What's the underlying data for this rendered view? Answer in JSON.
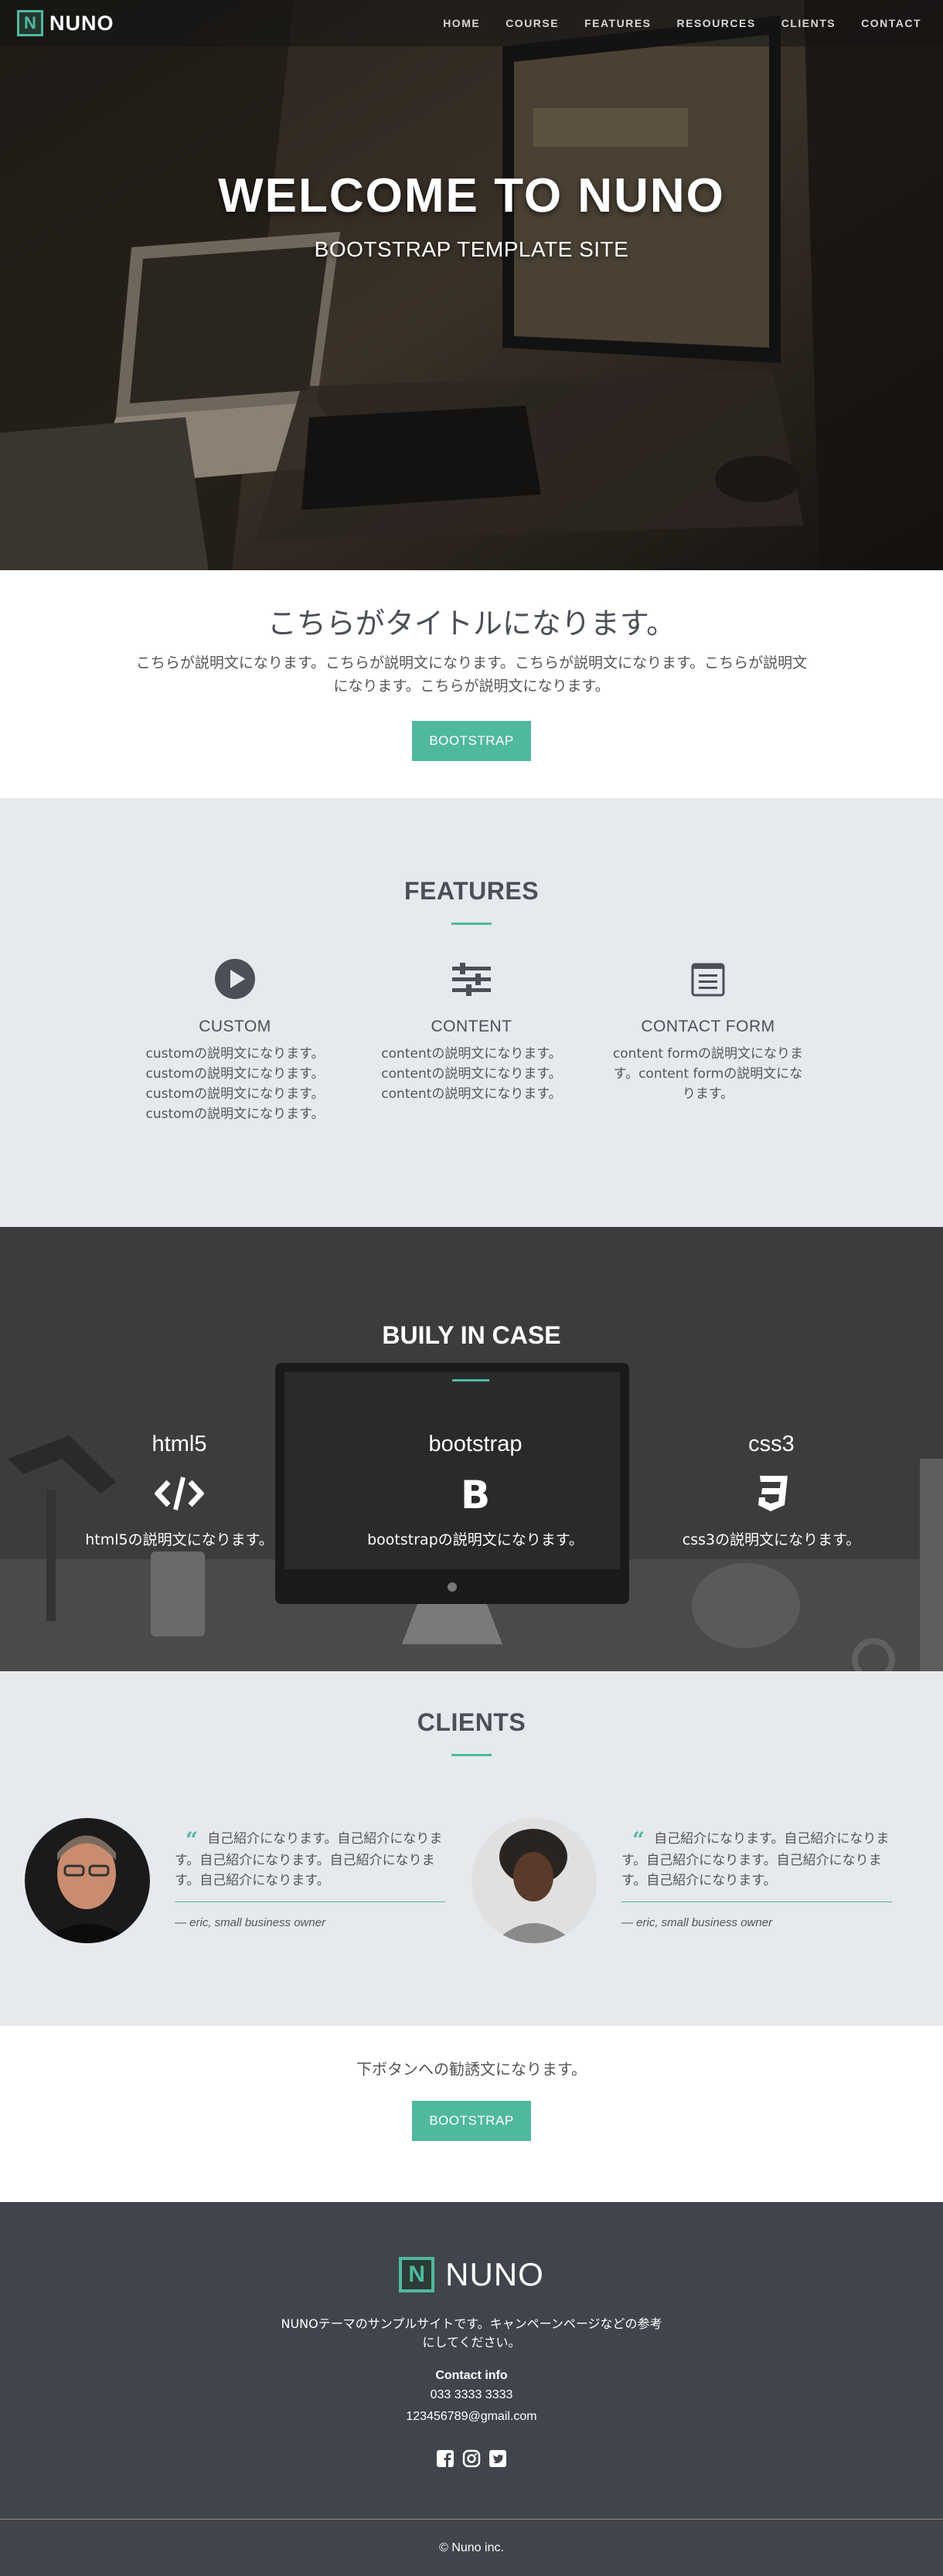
{
  "nav": {
    "brand": "NUNO",
    "brand_letter": "N",
    "links": [
      "HOME",
      "COURSE",
      "FEATURES",
      "RESOURCES",
      "CLIENTS",
      "CONTACT"
    ]
  },
  "hero": {
    "title": "WELCOME TO NUNO",
    "subtitle": "BOOTSTRAP TEMPLATE SITE"
  },
  "intro": {
    "title": "こちらがタイトルになります。",
    "description": "こちらが説明文になります。こちらが説明文になります。こちらが説明文になります。こちらが説明文になります。こちらが説明文になります。",
    "button": "BOOTSTRAP"
  },
  "features": {
    "title": "FEATURES",
    "items": [
      {
        "name": "CUSTOM",
        "icon": "play-circle-icon",
        "desc": "customの説明文になります。customの説明文になります。customの説明文になります。customの説明文になります。"
      },
      {
        "name": "CONTENT",
        "icon": "sliders-icon",
        "desc": "contentの説明文になります。contentの説明文になります。contentの説明文になります。"
      },
      {
        "name": "CONTACT FORM",
        "icon": "form-icon",
        "desc": "content formの説明文になります。content formの説明文になります。"
      }
    ]
  },
  "case": {
    "title": "BUILY IN CASE",
    "items": [
      {
        "name": "html5",
        "icon": "code-icon",
        "desc": "html5の説明文になります。"
      },
      {
        "name": "bootstrap",
        "icon": "bootstrap-icon",
        "desc": "bootstrapの説明文になります。"
      },
      {
        "name": "css3",
        "icon": "css3-icon",
        "desc": "css3の説明文になります。"
      }
    ]
  },
  "clients": {
    "title": "CLIENTS",
    "items": [
      {
        "quote": "自己紹介になります。自己紹介になります。自己紹介になります。自己紹介になります。自己紹介になります。",
        "by": "— eric, small business owner"
      },
      {
        "quote": "自己紹介になります。自己紹介になります。自己紹介になります。自己紹介になります。自己紹介になります。",
        "by": "— eric, small business owner"
      }
    ]
  },
  "cta": {
    "text": "下ボタンへの勧誘文になります。",
    "button": "BOOTSTRAP"
  },
  "footer": {
    "brand": "NUNO",
    "brand_letter": "N",
    "desc": "NUNOテーマのサンプルサイトです。キャンペーンページなどの参考にしてください。",
    "contact_title": "Contact info",
    "phone": "033 3333 3333",
    "email": "123456789@gmail.com",
    "social_icons": [
      "facebook-icon",
      "instagram-icon",
      "twitter-icon"
    ],
    "copyright": "© Nuno inc."
  },
  "colors": {
    "accent": "#4fb99f",
    "footer_bg": "#40444c",
    "section_bg": "#e6e9ed"
  }
}
